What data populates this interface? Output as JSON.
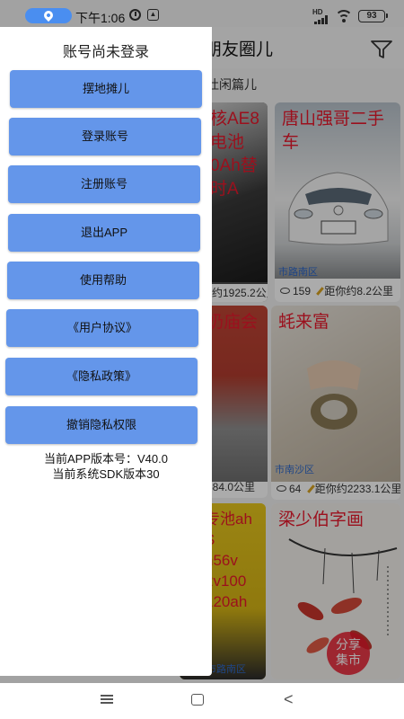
{
  "status_bar": {
    "time": "下午1:06",
    "battery": "93",
    "network_badge": "HD"
  },
  "background": {
    "title": "朋友圈儿",
    "subtitle": "吐闲篇儿",
    "cards": [
      {
        "title": "核AE8电池0Ah替\n时A",
        "views": "",
        "distance": "约1925.2公里",
        "location": ""
      },
      {
        "title": "唐山强哥二手车",
        "views": "159",
        "distance": "距你约8.2公里",
        "location": "市路南区"
      },
      {
        "title": "奶庙会",
        "views": "",
        "distance": "584.0公里",
        "location": ""
      },
      {
        "title": "蚝来富",
        "views": "64",
        "distance": "距你约2233.1公里",
        "location": "市南沙区"
      },
      {
        "title": "专池ah\nS\nh56v\n2v100\n120ah",
        "views": "",
        "distance": "",
        "location": "市路南区"
      },
      {
        "title": "梁少伯字画",
        "views": "",
        "distance": "",
        "location": ""
      }
    ],
    "share_button": "分享\n集市"
  },
  "drawer": {
    "title": "账号尚未登录",
    "buttons": [
      "摆地摊儿",
      "登录账号",
      "注册账号",
      "退出APP",
      "使用帮助",
      "《用户协议》",
      "《隐私政策》",
      "撤销隐私权限"
    ],
    "app_version": "当前APP版本号：V40.0",
    "sdk_version": "当前系统SDK版本30"
  },
  "colors": {
    "drawer_button": "#6496ea",
    "card_title": "#e8192c",
    "location_pill": "#4a8ef0"
  },
  "icons": [
    "location-pin-icon",
    "alarm-icon",
    "app-notification-icon",
    "signal-icon",
    "wifi-icon",
    "battery-icon",
    "filter-icon",
    "eye-icon",
    "pencil-icon",
    "nav-menu-icon",
    "nav-home-icon",
    "nav-back-icon"
  ]
}
